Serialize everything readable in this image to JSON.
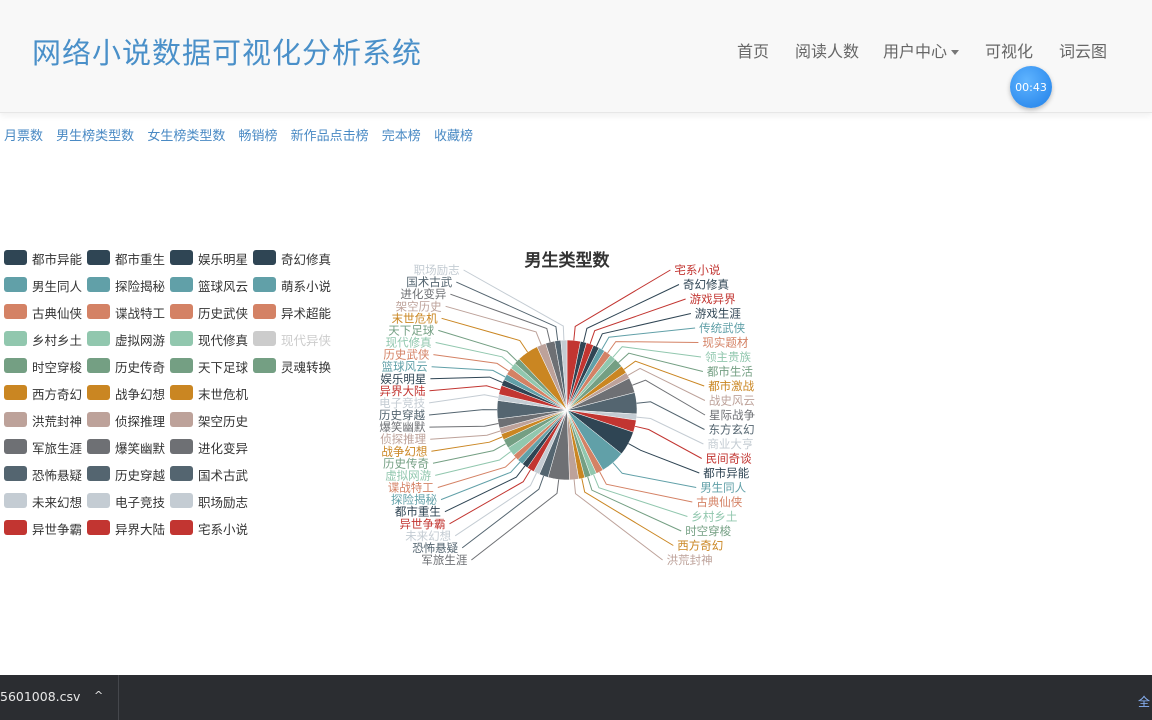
{
  "navbar": {
    "brand": "网络小说数据可视化分析系统",
    "items": [
      {
        "label": "首页"
      },
      {
        "label": "阅读人数"
      },
      {
        "label": "用户中心"
      },
      {
        "label": "可视化"
      },
      {
        "label": "词云图"
      }
    ]
  },
  "timer": "00:43",
  "subnav": [
    "月票数",
    "男生榜类型数",
    "女生榜类型数",
    "畅销榜",
    "新作品点击榜",
    "完本榜",
    "收藏榜"
  ],
  "taskbar": {
    "download_name": "5601008.csv",
    "chevron": "^",
    "right_text": "全"
  },
  "colors": {
    "brand": "#4a90c9",
    "link": "#4a8ac4",
    "palette": [
      "#2f4554",
      "#61a0a8",
      "#d48265",
      "#91c7ae",
      "#749f83",
      "#ca8622",
      "#bda29a",
      "#6e7074",
      "#546570",
      "#c4ccd3",
      "#c23531"
    ]
  },
  "chart_data": {
    "type": "pie",
    "title": "男生类型数",
    "legend": [
      {
        "name": "都市异能",
        "color": "#2f4554"
      },
      {
        "name": "男生同人",
        "color": "#61a0a8"
      },
      {
        "name": "古典仙侠",
        "color": "#d48265"
      },
      {
        "name": "乡村乡土",
        "color": "#91c7ae"
      },
      {
        "name": "时空穿梭",
        "color": "#749f83"
      },
      {
        "name": "西方奇幻",
        "color": "#ca8622"
      },
      {
        "name": "洪荒封神",
        "color": "#bda29a"
      },
      {
        "name": "军旅生涯",
        "color": "#6e7074"
      },
      {
        "name": "恐怖悬疑",
        "color": "#546570"
      },
      {
        "name": "未来幻想",
        "color": "#c4ccd3"
      },
      {
        "name": "异世争霸",
        "color": "#c23531"
      },
      {
        "name": "都市重生",
        "color": "#2f4554"
      },
      {
        "name": "探险揭秘",
        "color": "#61a0a8"
      },
      {
        "name": "谍战特工",
        "color": "#d48265"
      },
      {
        "name": "虚拟网游",
        "color": "#91c7ae"
      },
      {
        "name": "历史传奇",
        "color": "#749f83"
      },
      {
        "name": "战争幻想",
        "color": "#ca8622"
      },
      {
        "name": "侦探推理",
        "color": "#bda29a"
      },
      {
        "name": "爆笑幽默",
        "color": "#6e7074"
      },
      {
        "name": "历史穿越",
        "color": "#546570"
      },
      {
        "name": "电子竞技",
        "color": "#c4ccd3"
      },
      {
        "name": "异界大陆",
        "color": "#c23531"
      },
      {
        "name": "娱乐明星",
        "color": "#2f4554"
      },
      {
        "name": "篮球风云",
        "color": "#61a0a8"
      },
      {
        "name": "历史武侠",
        "color": "#d48265"
      },
      {
        "name": "现代修真",
        "color": "#91c7ae"
      },
      {
        "name": "天下足球",
        "color": "#749f83"
      },
      {
        "name": "末世危机",
        "color": "#ca8622"
      },
      {
        "name": "架空历史",
        "color": "#bda29a"
      },
      {
        "name": "进化变异",
        "color": "#6e7074"
      },
      {
        "name": "国术古武",
        "color": "#546570"
      },
      {
        "name": "职场励志",
        "color": "#c4ccd3"
      },
      {
        "name": "宅系小说",
        "color": "#c23531"
      },
      {
        "name": "奇幻修真",
        "color": "#2f4554"
      },
      {
        "name": "萌系小说",
        "color": "#61a0a8"
      },
      {
        "name": "异术超能",
        "color": "#d48265"
      },
      {
        "name": "现代异侠",
        "color": "#cccccc",
        "off": true
      },
      {
        "name": "灵魂转换",
        "color": "#749f83"
      }
    ],
    "slices": [
      {
        "name": "宅系小说",
        "value": 2.2,
        "color": "#c23531"
      },
      {
        "name": "奇幻修真",
        "value": 1.0,
        "color": "#2f4554"
      },
      {
        "name": "游戏异界",
        "value": 1.2,
        "color": "#c23531"
      },
      {
        "name": "游戏生涯",
        "value": 1.0,
        "color": "#2f4554"
      },
      {
        "name": "传统武侠",
        "value": 1.0,
        "color": "#61a0a8"
      },
      {
        "name": "现实题材",
        "value": 1.2,
        "color": "#d48265"
      },
      {
        "name": "领主贵族",
        "value": 1.0,
        "color": "#91c7ae"
      },
      {
        "name": "都市生活",
        "value": 1.5,
        "color": "#749f83"
      },
      {
        "name": "都市激战",
        "value": 1.3,
        "color": "#ca8622"
      },
      {
        "name": "战史风云",
        "value": 1.0,
        "color": "#bda29a"
      },
      {
        "name": "星际战争",
        "value": 2.5,
        "color": "#6e7074"
      },
      {
        "name": "东方玄幻",
        "value": 3.5,
        "color": "#546570"
      },
      {
        "name": "商业大亨",
        "value": 1.0,
        "color": "#c4ccd3"
      },
      {
        "name": "民间奇谈",
        "value": 2.0,
        "color": "#c23531"
      },
      {
        "name": "都市异能",
        "value": 4.0,
        "color": "#2f4554"
      },
      {
        "name": "男生同人",
        "value": 4.0,
        "color": "#61a0a8"
      },
      {
        "name": "古典仙侠",
        "value": 1.2,
        "color": "#d48265"
      },
      {
        "name": "乡村乡土",
        "value": 1.0,
        "color": "#91c7ae"
      },
      {
        "name": "时空穿梭",
        "value": 1.0,
        "color": "#749f83"
      },
      {
        "name": "西方奇幻",
        "value": 1.0,
        "color": "#ca8622"
      },
      {
        "name": "洪荒封神",
        "value": 1.5,
        "color": "#bda29a"
      },
      {
        "name": "军旅生涯",
        "value": 3.5,
        "color": "#6e7074"
      },
      {
        "name": "恐怖悬疑",
        "value": 1.5,
        "color": "#546570"
      },
      {
        "name": "未来幻想",
        "value": 1.0,
        "color": "#c4ccd3"
      },
      {
        "name": "异世争霸",
        "value": 1.2,
        "color": "#c23531"
      },
      {
        "name": "都市重生",
        "value": 1.0,
        "color": "#2f4554"
      },
      {
        "name": "探险揭秘",
        "value": 1.0,
        "color": "#61a0a8"
      },
      {
        "name": "谍战特工",
        "value": 1.0,
        "color": "#d48265"
      },
      {
        "name": "虚拟网游",
        "value": 1.5,
        "color": "#91c7ae"
      },
      {
        "name": "历史传奇",
        "value": 1.5,
        "color": "#749f83"
      },
      {
        "name": "战争幻想",
        "value": 1.0,
        "color": "#ca8622"
      },
      {
        "name": "侦探推理",
        "value": 1.0,
        "color": "#bda29a"
      },
      {
        "name": "爆笑幽默",
        "value": 1.5,
        "color": "#6e7074"
      },
      {
        "name": "历史穿越",
        "value": 3.0,
        "color": "#546570"
      },
      {
        "name": "电子竞技",
        "value": 1.0,
        "color": "#c4ccd3"
      },
      {
        "name": "异界大陆",
        "value": 1.5,
        "color": "#c23531"
      },
      {
        "name": "娱乐明星",
        "value": 1.0,
        "color": "#2f4554"
      },
      {
        "name": "篮球风云",
        "value": 1.0,
        "color": "#61a0a8"
      },
      {
        "name": "历史武侠",
        "value": 1.2,
        "color": "#d48265"
      },
      {
        "name": "现代修真",
        "value": 1.0,
        "color": "#91c7ae"
      },
      {
        "name": "天下足球",
        "value": 1.0,
        "color": "#749f83"
      },
      {
        "name": "末世危机",
        "value": 3.5,
        "color": "#ca8622"
      },
      {
        "name": "架空历史",
        "value": 1.5,
        "color": "#bda29a"
      },
      {
        "name": "进化变异",
        "value": 1.5,
        "color": "#6e7074"
      },
      {
        "name": "国术古武",
        "value": 1.0,
        "color": "#546570"
      },
      {
        "name": "职场励志",
        "value": 1.0,
        "color": "#c4ccd3"
      }
    ]
  }
}
